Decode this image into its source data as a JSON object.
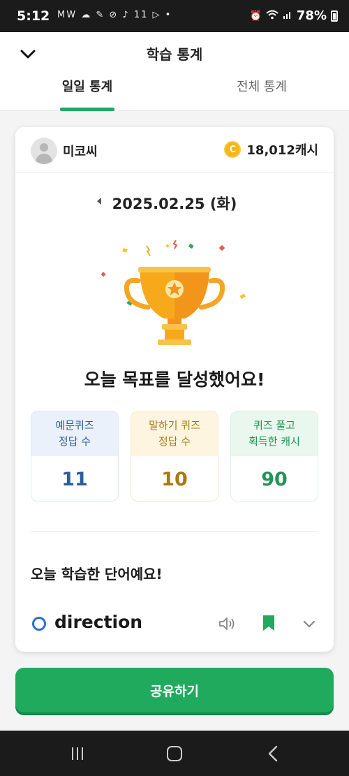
{
  "status_bar": {
    "time": "5:12",
    "left_icons": "MW ☁ ✎ ⊘ ♪ 11 ▷ •",
    "battery": "78%"
  },
  "header": {
    "title": "학습 통계",
    "tabs": [
      {
        "label": "일일 통계",
        "active": true
      },
      {
        "label": "전체 통계",
        "active": false
      }
    ]
  },
  "card": {
    "user": {
      "name": "미코씨"
    },
    "cash": {
      "coin_letter": "C",
      "amount": "18,012캐시"
    },
    "date": "2025.02.25 (화)",
    "goal_message": "오늘 목표를 달성했어요!",
    "stats": [
      {
        "label_line1": "예문퀴즈",
        "label_line2": "정답 수",
        "value": "11",
        "color": "#2d5c9c"
      },
      {
        "label_line1": "말하기 퀴즈",
        "label_line2": "정답 수",
        "value": "10",
        "color": "#a87a10"
      },
      {
        "label_line1": "퀴즈 풀고",
        "label_line2": "획득한 캐시",
        "value": "90",
        "color": "#219455"
      }
    ],
    "words_title": "오늘 학습한 단어예요!",
    "words": [
      {
        "word": "direction"
      }
    ]
  },
  "share_button": {
    "label": "공유하기"
  },
  "colors": {
    "accent": "#1faa5e",
    "word_circle": "#2d6fd0",
    "trophy": "#f7a91c"
  },
  "icons": {
    "back": "chevron-down-icon",
    "date_prev": "caret-left-icon",
    "speaker": "speaker-icon",
    "bookmark": "bookmark-icon",
    "expand": "chevron-down-icon",
    "nav": [
      "recents-icon",
      "home-icon",
      "back-icon"
    ]
  }
}
